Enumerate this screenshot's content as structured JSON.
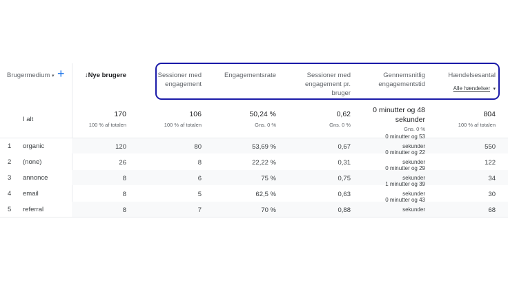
{
  "header": {
    "dimension_label": "Brugermedium",
    "columns": [
      {
        "label": "↓Nye brugere"
      },
      {
        "label": "Sessioner med engagement"
      },
      {
        "label": "Engagementsrate"
      },
      {
        "label": "Sessioner med engagement pr. bruger"
      },
      {
        "label": "Gennemsnitlig engagementstid"
      },
      {
        "label": "Hændelsesantal",
        "sublabel": "Alle hændelser"
      }
    ]
  },
  "totals": {
    "label": "I alt",
    "new_users": "170",
    "new_users_sub": "100 % af totalen",
    "engaged_sessions": "106",
    "engaged_sessions_sub": "100 % af totalen",
    "engagement_rate": "50,24 %",
    "engagement_rate_sub": "Gns. 0 %",
    "per_user": "0,62",
    "per_user_sub": "Gns. 0 %",
    "avg_time": "0 minutter og 48 sekunder",
    "avg_time_sub": "Gns. 0 %",
    "events": "804",
    "events_sub": "100 % af totalen"
  },
  "rows": [
    {
      "num": "1",
      "medium": "organic",
      "new_users": "120",
      "engaged_sessions": "80",
      "engagement_rate": "53,69 %",
      "per_user": "0,67",
      "avg_time_top": "0 minutter og 53",
      "avg_time_bottom": "sekunder",
      "events": "550"
    },
    {
      "num": "2",
      "medium": "(none)",
      "new_users": "26",
      "engaged_sessions": "8",
      "engagement_rate": "22,22 %",
      "per_user": "0,31",
      "avg_time_top": "0 minutter og 22",
      "avg_time_bottom": "sekunder",
      "events": "122"
    },
    {
      "num": "3",
      "medium": "annonce",
      "new_users": "8",
      "engaged_sessions": "6",
      "engagement_rate": "75 %",
      "per_user": "0,75",
      "avg_time_top": "0 minutter og 29",
      "avg_time_bottom": "sekunder",
      "events": "34"
    },
    {
      "num": "4",
      "medium": "email",
      "new_users": "8",
      "engaged_sessions": "5",
      "engagement_rate": "62,5 %",
      "per_user": "0,63",
      "avg_time_top": "1 minutter og 39",
      "avg_time_bottom": "sekunder",
      "events": "30"
    },
    {
      "num": "5",
      "medium": "referral",
      "new_users": "8",
      "engaged_sessions": "7",
      "engagement_rate": "70 %",
      "per_user": "0,88",
      "avg_time_top": "0 minutter og 43",
      "avg_time_bottom": "sekunder",
      "events": "68"
    }
  ],
  "colors": {
    "highlight_border": "#1a1aa8",
    "add_icon": "#1a73e8"
  }
}
